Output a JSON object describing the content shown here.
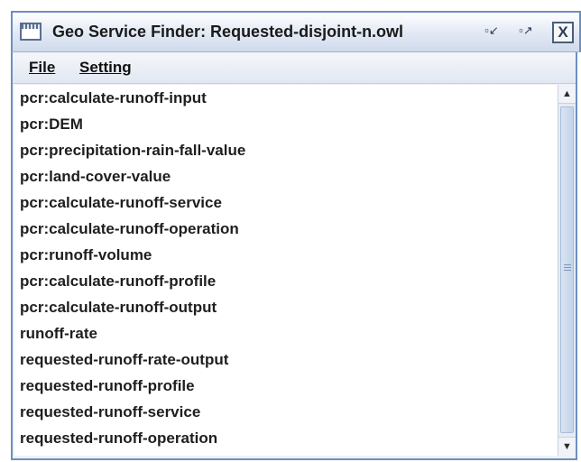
{
  "window": {
    "title": "Geo Service Finder: Requested-disjoint-n.owl",
    "minimize_glyph": "▫↙",
    "maximize_glyph": "▫↗",
    "close_glyph": "X"
  },
  "menu": {
    "items": [
      {
        "label": "File"
      },
      {
        "label": "Setting"
      }
    ]
  },
  "list": {
    "items": [
      "pcr:calculate-runoff-input",
      "pcr:DEM",
      "pcr:precipitation-rain-fall-value",
      "pcr:land-cover-value",
      "pcr:calculate-runoff-service",
      "pcr:calculate-runoff-operation",
      "pcr:runoff-volume",
      "pcr:calculate-runoff-profile",
      "pcr:calculate-runoff-output",
      "runoff-rate",
      "requested-runoff-rate-output",
      "requested-runoff-profile",
      "requested-runoff-service",
      "requested-runoff-operation"
    ]
  },
  "scrollbar": {
    "up_glyph": "▲",
    "down_glyph": "▼"
  },
  "colors": {
    "window_border": "#6b8fbf",
    "titlebar_gradient_end": "#cfdaeb"
  }
}
